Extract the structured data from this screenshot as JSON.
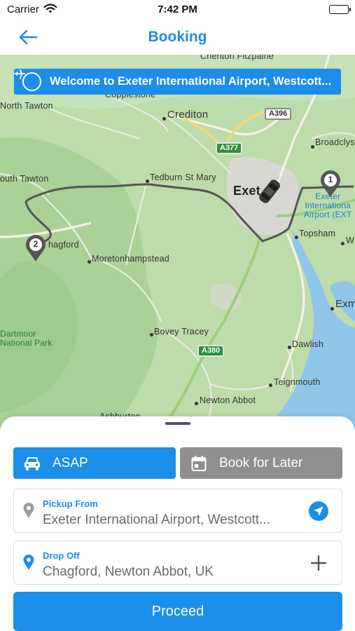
{
  "status": {
    "carrier": "Carrier",
    "time": "7:42 PM"
  },
  "nav": {
    "title": "Booking"
  },
  "map": {
    "banner": "Welcome to Exeter International Airport, Westcott...",
    "labels": {
      "cheriton": "Cheriton Fitzpaine",
      "copplestone": "Copplestone",
      "north_tawton": "North Tawton",
      "crediton": "Crediton",
      "broadclyst": "Broadclys",
      "south_tawton": "outh Tawton",
      "tedburn": "Tedburn St Mary",
      "exeter": "Exet",
      "airport": "Exeter\nInternationa\nAirport (EXT",
      "chagford": "hagford",
      "moreton": "Moretonhampstead",
      "topsham": "Topsham",
      "woodbury": "W",
      "exmouth": "Exm",
      "dartmoor": "Dartmoor\nNational Park",
      "bovey": "Bovey Tracey",
      "dawlish": "Dawlish",
      "teignmouth": "Teignmouth",
      "newton_abbot": "Newton Abbot",
      "ashburton": "Ashburton"
    },
    "roads": {
      "a396": "A396",
      "a377": "A377",
      "a380": "A380"
    },
    "pins": {
      "pickup": "1",
      "dropoff": "2"
    }
  },
  "booking": {
    "asap_label": "ASAP",
    "later_label": "Book for Later",
    "pickup_label": "Pickup From",
    "pickup_value": "Exeter International Airport, Westcott...",
    "dropoff_label": "Drop Off",
    "dropoff_value": "Chagford, Newton Abbot, UK",
    "proceed_label": "Proceed"
  },
  "colors": {
    "accent": "#1a8ee8",
    "secondary": "#8f8f8f",
    "route": "#555555"
  }
}
